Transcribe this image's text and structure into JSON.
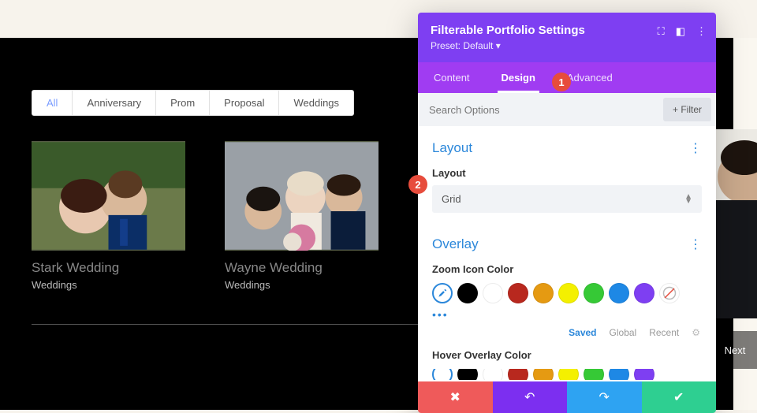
{
  "filters": {
    "items": [
      "All",
      "Anniversary",
      "Prom",
      "Proposal",
      "Weddings"
    ],
    "active": 0
  },
  "gallery": {
    "items": [
      {
        "title": "Stark Wedding",
        "category": "Weddings"
      },
      {
        "title": "Wayne Wedding",
        "category": "Weddings"
      }
    ]
  },
  "next_label": "Next",
  "panel": {
    "title": "Filterable Portfolio Settings",
    "preset": "Preset: Default ▾",
    "tabs": {
      "items": [
        "Content",
        "Design",
        "Advanced"
      ],
      "active": 1
    },
    "search_placeholder": "Search Options",
    "filter_button": "+ Filter",
    "sections": {
      "layout": {
        "title": "Layout",
        "field_label": "Layout",
        "value": "Grid"
      },
      "overlay": {
        "title": "Overlay",
        "zoom_label": "Zoom Icon Color",
        "hover_label": "Hover Overlay Color",
        "swatch_tabs": [
          "Saved",
          "Global",
          "Recent"
        ],
        "swatch_tabs_active": 0,
        "colors": [
          "#000000",
          "#ffffff",
          "#b8281e",
          "#e59a12",
          "#f4f000",
          "#36c936",
          "#1e88e5",
          "#7e3ff2"
        ]
      }
    }
  },
  "badges": {
    "one": "1",
    "two": "2"
  }
}
